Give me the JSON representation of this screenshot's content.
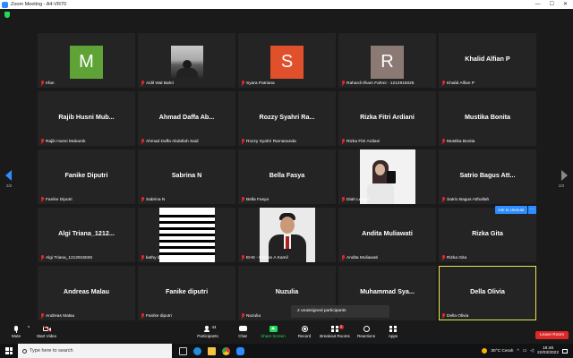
{
  "window": {
    "title": "Zoom Meeting - A4-VR70",
    "controls": [
      "—",
      "☐",
      "✕"
    ]
  },
  "tiles": [
    {
      "id": "irfan",
      "label": "Irfan",
      "avatar_letter": "M",
      "avatar_color": "#5fa336"
    },
    {
      "id": "aidil",
      "label": "Aidil Wal Bahri",
      "photo": "camera-dark"
    },
    {
      "id": "syara",
      "label": "Syara Patriana",
      "avatar_letter": "S",
      "avatar_color": "#e0502a"
    },
    {
      "id": "rahardi",
      "label": "Rahardi Ilham Fahmi - 1212915025",
      "avatar_letter": "R",
      "avatar_color": "#8a7a73"
    },
    {
      "id": "khalid",
      "label": "Khalid Alfian P",
      "big_name": "Khalid Alfian P"
    },
    {
      "id": "rajib",
      "label": "Rajib Husni Mubarok",
      "big_name": "Rajib Husni Mub..."
    },
    {
      "id": "ahmad",
      "label": "Ahmad Daffa Abdullah Said",
      "big_name": "Ahmad Daffa Ab..."
    },
    {
      "id": "rozzy",
      "label": "Rozzy Syahri Ramananda",
      "big_name": "Rozzy Syahri Ra..."
    },
    {
      "id": "rizka-fitri",
      "label": "Rizka Fitri Ardiani",
      "big_name": "Rizka Fitri Ardiani"
    },
    {
      "id": "mustika",
      "label": "Mustika Bonita",
      "big_name": "Mustika Bonita"
    },
    {
      "id": "fanike-1",
      "label": "Fanike Diputri",
      "big_name": "Fanike Diputri"
    },
    {
      "id": "sabrina",
      "label": "Sabrina N",
      "big_name": "Sabrina N"
    },
    {
      "id": "bella",
      "label": "Bella Fasya",
      "big_name": "Bella Fasya"
    },
    {
      "id": "diah",
      "label": "Diah Lestari",
      "photo": "selfie"
    },
    {
      "id": "satrio",
      "label": "Satrio Bagus Atthallah",
      "big_name": "Satrio Bagus Att..."
    },
    {
      "id": "algi",
      "label": "Algi Triana_1212915026",
      "big_name": "Algi Triana_1212..."
    },
    {
      "id": "kathy",
      "label": "kathy desintya",
      "photo": "stripes"
    },
    {
      "id": "ehs",
      "label": "EHS - Usman A Kamil",
      "photo": "portrait"
    },
    {
      "id": "andita",
      "label": "Andita Muliawati",
      "big_name": "Andita Muliawati"
    },
    {
      "id": "rizka-gita",
      "label": "Rizka Gita",
      "big_name": "Rizka Gita"
    },
    {
      "id": "andreas",
      "label": "Andreas Malau",
      "big_name": "Andreas Malau"
    },
    {
      "id": "fanike-2",
      "label": "Fanike diputri",
      "big_name": "Fanike diputri"
    },
    {
      "id": "nuzulia",
      "label": "Nuzulia",
      "big_name": "Nuzulia"
    },
    {
      "id": "muhammad",
      "label": "gi",
      "big_name": "Muhammad Sya..."
    },
    {
      "id": "della",
      "label": "Della Olivia",
      "big_name": "Della Olivia",
      "active": true
    }
  ],
  "paging": {
    "left": "2/2",
    "right": "2/2"
  },
  "ask_to_unmute": "Ask to Unmute",
  "unassigned": "2 unassigned participants",
  "toolbar": {
    "mute": "Mute",
    "start_video": "Start Video",
    "participants": "Participants",
    "participants_count": "44",
    "chat": "Chat",
    "share_screen": "Share Screen",
    "record": "Record",
    "breakout": "Breakout Rooms",
    "breakout_badge": "2",
    "reactions": "Reactions",
    "apps": "Apps",
    "leave": "Leave Room"
  },
  "taskbar": {
    "search_placeholder": "Type here to search",
    "weather": "30°C Cerah",
    "time": "18:48",
    "date": "22/03/2022"
  },
  "colors": {
    "accent": "#2d8cff",
    "active_border": "#e5e84d",
    "danger": "#e02828",
    "share": "#23d959"
  }
}
